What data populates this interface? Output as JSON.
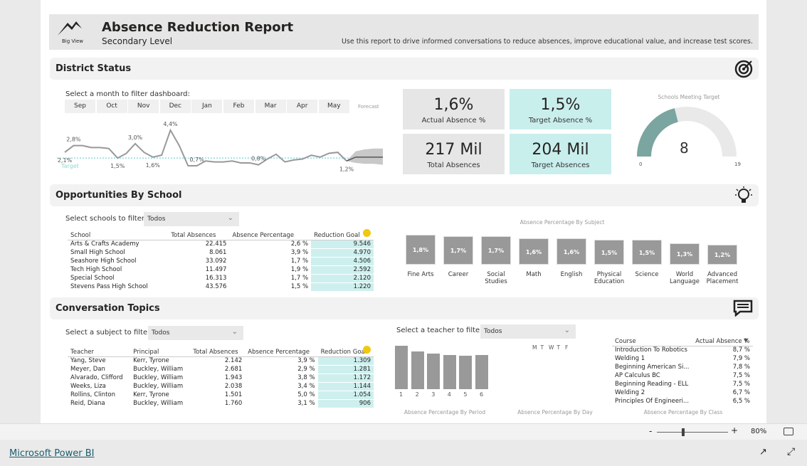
{
  "header": {
    "logo_text": "Big View",
    "title": "Absence Reduction Report",
    "subtitle": "Secondary Level",
    "description": "Use this report to drive informed conversations to reduce absences, improve educational value, and increase test scores."
  },
  "district": {
    "section_title": "District Status",
    "icon": "target-icon",
    "month_filter_label": "Select a month to filter dashboard:",
    "months": [
      "Sep",
      "Oct",
      "Nov",
      "Dec",
      "Jan",
      "Feb",
      "Mar",
      "Apr",
      "May"
    ],
    "forecast_label": "Forecast",
    "target_label": "Target",
    "trend": {
      "type": "line",
      "target": 1.5,
      "values": [
        2.1,
        2.8,
        2.8,
        2.6,
        2.6,
        2.5,
        1.5,
        2.0,
        3.0,
        2.1,
        1.6,
        1.8,
        4.4,
        2.8,
        0.7,
        0.7,
        1.2,
        1.1,
        1.1,
        1.2,
        1.0,
        1.0,
        0.8,
        1.4,
        1.9,
        1.1,
        1.3,
        1.4,
        1.8,
        1.6,
        2.0,
        2.1,
        1.2
      ],
      "forecast": [
        1.2,
        1.6,
        1.6,
        1.6,
        1.6
      ],
      "forecast_low": [
        1.2,
        1.0,
        0.9,
        0.9,
        0.8
      ],
      "forecast_high": [
        1.2,
        2.2,
        2.4,
        2.5,
        2.5
      ],
      "data_labels": [
        {
          "i": 0,
          "text": "2,1%"
        },
        {
          "i": 1,
          "text": "2,8%"
        },
        {
          "i": 6,
          "text": "1,5%"
        },
        {
          "i": 8,
          "text": "3,0%"
        },
        {
          "i": 10,
          "text": "1,6%"
        },
        {
          "i": 12,
          "text": "4,4%"
        },
        {
          "i": 15,
          "text": "0,7%"
        },
        {
          "i": 22,
          "text": "0,8%"
        },
        {
          "i": 32,
          "text": "1,2%"
        }
      ],
      "color": "#999999",
      "target_color": "#a6e3df"
    },
    "kpis": [
      {
        "value": "1,6%",
        "caption": "Actual Absence %"
      },
      {
        "value": "1,5%",
        "caption": "Target Absence %"
      },
      {
        "value": "217 Mil",
        "caption": "Total Absences"
      },
      {
        "value": "204 Mil",
        "caption": "Target Absences"
      }
    ],
    "gauge": {
      "title": "Schools Meeting Target",
      "value": 8,
      "min": 0,
      "max": 19,
      "min_label": "0",
      "max_label": "19",
      "value_label": "8",
      "fill_color": "#7aa5a0"
    }
  },
  "schools": {
    "section_title": "Opportunities By School",
    "icon": "lightbulb-icon",
    "filter_label": "Select schools to filter:",
    "filter_value": "Todos",
    "columns": [
      "School",
      "Total Absences",
      "Absence Percentage",
      "Reduction Goal"
    ],
    "rows": [
      [
        "Arts & Crafts Academy",
        "22.415",
        "2,6 %",
        "9.546"
      ],
      [
        "Small High School",
        "8.061",
        "3,9 %",
        "4.970"
      ],
      [
        "Seashore High School",
        "33.092",
        "1,7 %",
        "4.506"
      ],
      [
        "Tech High School",
        "11.497",
        "1,9 %",
        "2.592"
      ],
      [
        "Special School",
        "16.313",
        "1,7 %",
        "2.120"
      ],
      [
        "Stevens Pass High School",
        "43.576",
        "1,5 %",
        "1.220"
      ]
    ],
    "subject_chart": {
      "type": "bar",
      "title": "Absence Percentage By Subject",
      "categories": [
        "Fine Arts",
        "Career",
        "Social Studies",
        "Math",
        "English",
        "Physical Education",
        "Science",
        "World Language",
        "Advanced Placement"
      ],
      "values": [
        1.8,
        1.7,
        1.7,
        1.6,
        1.6,
        1.5,
        1.5,
        1.3,
        1.2
      ],
      "labels": [
        "1,8%",
        "1,7%",
        "1,7%",
        "1,6%",
        "1,6%",
        "1,5%",
        "1,5%",
        "1,3%",
        "1,2%"
      ]
    }
  },
  "conversation": {
    "section_title": "Conversation Topics",
    "icon": "chat-icon",
    "subject_filter_label": "Select a subject to filter:",
    "subject_filter_value": "Todos",
    "teacher_filter_label": "Select a teacher to filter:",
    "teacher_filter_value": "Todos",
    "columns": [
      "Teacher",
      "Principal",
      "Total Absences",
      "Absence Percentage",
      "Reduction Goal"
    ],
    "rows": [
      [
        "Yang, Steve",
        "Kerr, Tyrone",
        "2.142",
        "3,9 %",
        "1.309"
      ],
      [
        "Meyer, Dan",
        "Buckley, William",
        "2.681",
        "2,9 %",
        "1.281"
      ],
      [
        "Alvarado, Clifford",
        "Buckley, William",
        "1.943",
        "3,8 %",
        "1.172"
      ],
      [
        "Weeks, Liza",
        "Buckley, William",
        "2.038",
        "3,4 %",
        "1.144"
      ],
      [
        "Rollins, Clinton",
        "Kerr, Tyrone",
        "1.501",
        "5,0 %",
        "1.054"
      ],
      [
        "Reid, Diana",
        "Buckley, William",
        "1.760",
        "3,1 %",
        "906"
      ]
    ],
    "period_chart": {
      "type": "bar",
      "title": "Absence Percentage By Period",
      "categories": [
        "1",
        "2",
        "3",
        "4",
        "5",
        "6"
      ],
      "values": [
        61,
        53,
        50,
        48,
        47,
        48
      ]
    },
    "day_chart": {
      "title": "Absence Percentage By Day",
      "categories": [
        "M",
        "T",
        "W",
        "T",
        "F"
      ]
    },
    "class_table": {
      "title": "Absence Percentage By Class",
      "columns": [
        "Course",
        "Actual Absence %"
      ],
      "rows": [
        [
          "Introduction To Robotics",
          "8,7 %"
        ],
        [
          "Welding 1",
          "7,9 %"
        ],
        [
          "Beginning American Si...",
          "7,8 %"
        ],
        [
          "AP Calculus BC",
          "7,5 %"
        ],
        [
          "Beginning Reading - ELL",
          "7,5 %"
        ],
        [
          "Welding 2",
          "6,7 %"
        ],
        [
          "Principles Of Engineeri...",
          "6,5 %"
        ]
      ]
    }
  },
  "statusbar": {
    "zoom": "80%",
    "minus": "-",
    "plus": "+"
  },
  "footer": {
    "link": "Microsoft Power BI"
  }
}
